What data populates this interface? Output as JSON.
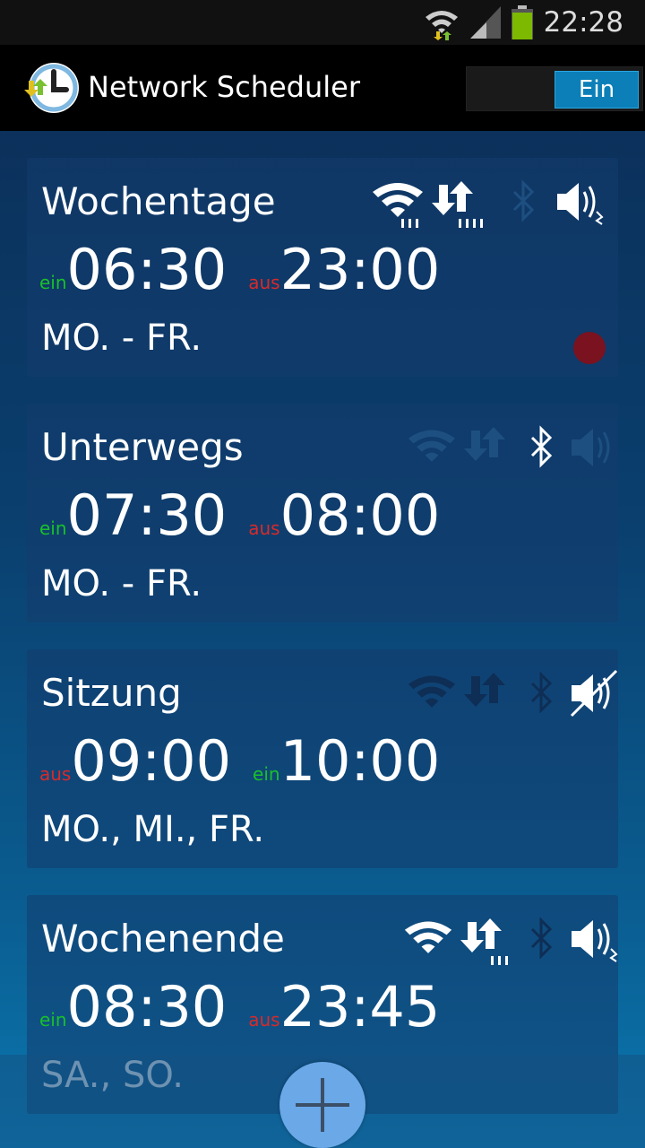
{
  "status_bar": {
    "time": "22:28"
  },
  "app": {
    "title": "Network Scheduler",
    "master_toggle": "Ein"
  },
  "schedules": [
    {
      "name": "Wochentage",
      "first_label": "ein",
      "first_time": "06:30",
      "second_label": "aus",
      "second_time": "23:00",
      "days": "MO. - FR.",
      "active": true,
      "icons": {
        "wifi": "on",
        "data": "on",
        "bluetooth": "off",
        "sound": "on"
      }
    },
    {
      "name": "Unterwegs",
      "first_label": "ein",
      "first_time": "07:30",
      "second_label": "aus",
      "second_time": "08:00",
      "days": "MO. - FR.",
      "active": false,
      "icons": {
        "wifi": "off",
        "data": "off",
        "bluetooth": "on",
        "sound": "off"
      }
    },
    {
      "name": "Sitzung",
      "first_label": "aus",
      "first_time": "09:00",
      "second_label": "ein",
      "second_time": "10:00",
      "days": "MO., MI., FR.",
      "active": false,
      "icons": {
        "wifi": "off",
        "data": "off",
        "bluetooth": "off",
        "sound": "mute"
      }
    },
    {
      "name": "Wochenende",
      "first_label": "ein",
      "first_time": "08:30",
      "second_label": "aus",
      "second_time": "23:45",
      "days": "SA., SO.",
      "active": false,
      "icons": {
        "wifi": "on",
        "data": "on",
        "bluetooth": "off",
        "sound": "on"
      }
    }
  ],
  "colors": {
    "ein": "#19c02a",
    "aus": "#d82a2a",
    "accent": "#0c7fb8"
  }
}
